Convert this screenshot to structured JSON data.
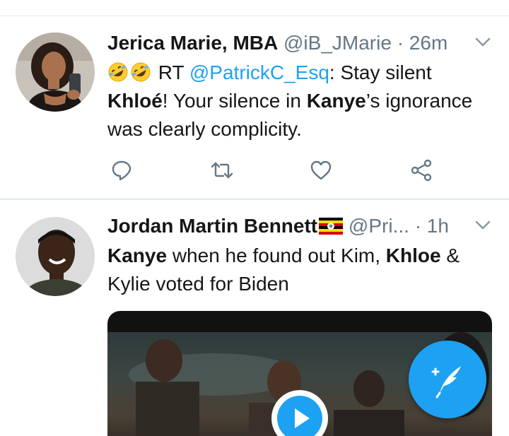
{
  "tweets": [
    {
      "display_name": "Jerica Marie, MBA",
      "handle": "@iB_JMarie",
      "separator": "·",
      "time": "26m",
      "avatar": "woman-selfie-avatar",
      "body": {
        "emoji": [
          "rolling-on-floor-laughing",
          "rolling-on-floor-laughing"
        ],
        "prefix": " RT ",
        "mention": "@PatrickC_Esq",
        "after_mention": ": Stay silent ",
        "bold_1": "Khloé",
        "mid": "! Your silence in ",
        "bold_2": "Kanye",
        "suffix": "’s ignorance was clearly complicity."
      },
      "actions": [
        "reply-icon",
        "retweet-icon",
        "like-icon",
        "share-icon"
      ]
    },
    {
      "display_name": "Jordan Martin Bennett",
      "flag": "uganda-flag",
      "handle": "@Pri...",
      "separator": "·",
      "time": "1h",
      "avatar": "man-smiling-avatar",
      "body": {
        "bold_1": "Kanye",
        "mid_1": " when he found out Kim, ",
        "bold_2": "Khloe",
        "suffix": " & Kylie voted for Biden"
      },
      "media": {
        "type": "video",
        "control": "play-icon"
      }
    }
  ],
  "compose_button": {
    "icon": "compose-tweet-icon"
  },
  "colors": {
    "accent": "#1da1f2",
    "secondary_text": "#657786",
    "divider": "#e1e8ed"
  }
}
